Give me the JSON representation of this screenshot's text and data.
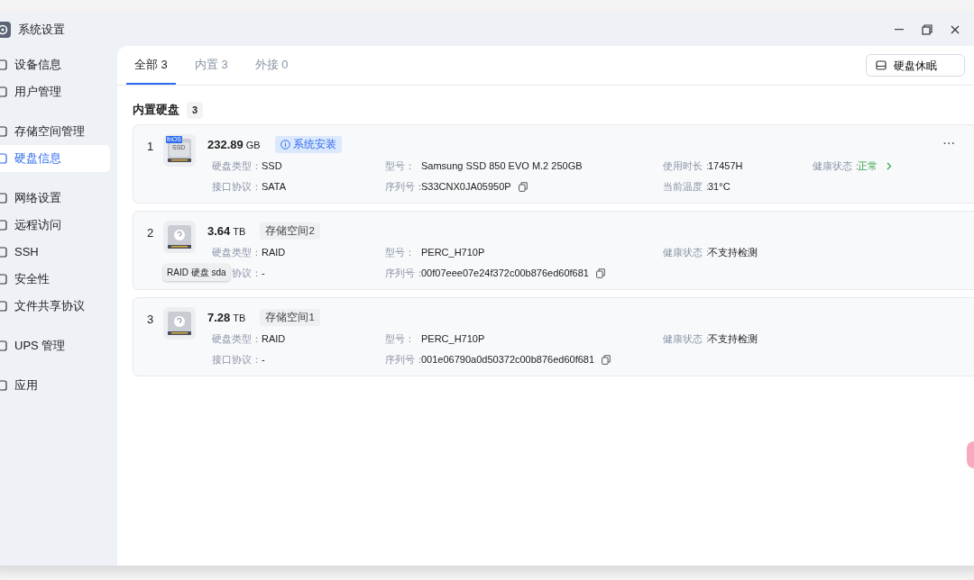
{
  "window": {
    "title": "系统设置"
  },
  "sidebar": {
    "groups": [
      [
        {
          "label": "设备信息",
          "selected": false
        },
        {
          "label": "用户管理",
          "selected": false
        }
      ],
      [
        {
          "label": "存储空间管理",
          "selected": false
        },
        {
          "label": "硬盘信息",
          "selected": true
        }
      ],
      [
        {
          "label": "网络设置",
          "selected": false
        },
        {
          "label": "远程访问",
          "selected": false
        },
        {
          "label": "SSH",
          "selected": false
        },
        {
          "label": "安全性",
          "selected": false
        },
        {
          "label": "文件共享协议",
          "selected": false
        }
      ],
      [
        {
          "label": "UPS 管理",
          "selected": false
        }
      ],
      [
        {
          "label": "应用",
          "selected": false
        }
      ]
    ]
  },
  "tabs": [
    {
      "label": "全部 3",
      "selected": true
    },
    {
      "label": "内置 3",
      "selected": false
    },
    {
      "label": "外接 0",
      "selected": false
    }
  ],
  "sleep_button": "硬盘休眠",
  "section": {
    "title": "内置硬盘",
    "count": "3"
  },
  "disks": [
    {
      "index": "1",
      "icon": {
        "kind": "ssd",
        "tag": "fnOS",
        "text": "SSD"
      },
      "size": "232.89",
      "unit": "GB",
      "tag": {
        "kind": "system",
        "label": "系统安装"
      },
      "menu": "···",
      "rows": [
        [
          {
            "label": "硬盘类型：",
            "value": "SSD",
            "kind": "text"
          },
          {
            "label": "型号：",
            "value": "Samsung SSD 850 EVO M.2 250GB",
            "kind": "text"
          },
          {
            "label": "使用时长：",
            "value": "17457H",
            "kind": "text"
          },
          {
            "label": "健康状态：",
            "value": "正常",
            "kind": "status",
            "healthy": true
          }
        ],
        [
          {
            "label": "接口协议：",
            "value": "SATA",
            "kind": "text"
          },
          {
            "label": "序列号：",
            "value": "S33CNX0JA05950P",
            "kind": "copy"
          },
          {
            "label": "当前温度：",
            "value": "31°C",
            "kind": "text"
          }
        ]
      ]
    },
    {
      "index": "2",
      "icon": {
        "kind": "unknown"
      },
      "size": "3.64",
      "unit": "TB",
      "tag": {
        "kind": "pool",
        "label": "存储空间2"
      },
      "tooltip": "RAID 硬盘 sda",
      "rows": [
        [
          {
            "label": "硬盘类型：",
            "value": "RAID",
            "kind": "text"
          },
          {
            "label": "型号：",
            "value": "PERC_H710P",
            "kind": "text"
          },
          {
            "label": "健康状态：",
            "value": "不支持检测",
            "kind": "status",
            "healthy": false
          }
        ],
        [
          {
            "label": "协议：",
            "value": "-",
            "kind": "text"
          },
          {
            "label": "序列号：",
            "value": "00f07eee07e24f372c00b876ed60f681",
            "kind": "copy"
          }
        ]
      ]
    },
    {
      "index": "3",
      "icon": {
        "kind": "unknown"
      },
      "size": "7.28",
      "unit": "TB",
      "tag": {
        "kind": "pool",
        "label": "存储空间1"
      },
      "rows": [
        [
          {
            "label": "硬盘类型：",
            "value": "RAID",
            "kind": "text"
          },
          {
            "label": "型号：",
            "value": "PERC_H710P",
            "kind": "text"
          },
          {
            "label": "健康状态：",
            "value": "不支持检测",
            "kind": "status",
            "healthy": false
          }
        ],
        [
          {
            "label": "接口协议：",
            "value": "-",
            "kind": "text"
          },
          {
            "label": "序列号：",
            "value": "001e06790a0d50372c00b876ed60f681",
            "kind": "copy"
          }
        ]
      ]
    }
  ]
}
